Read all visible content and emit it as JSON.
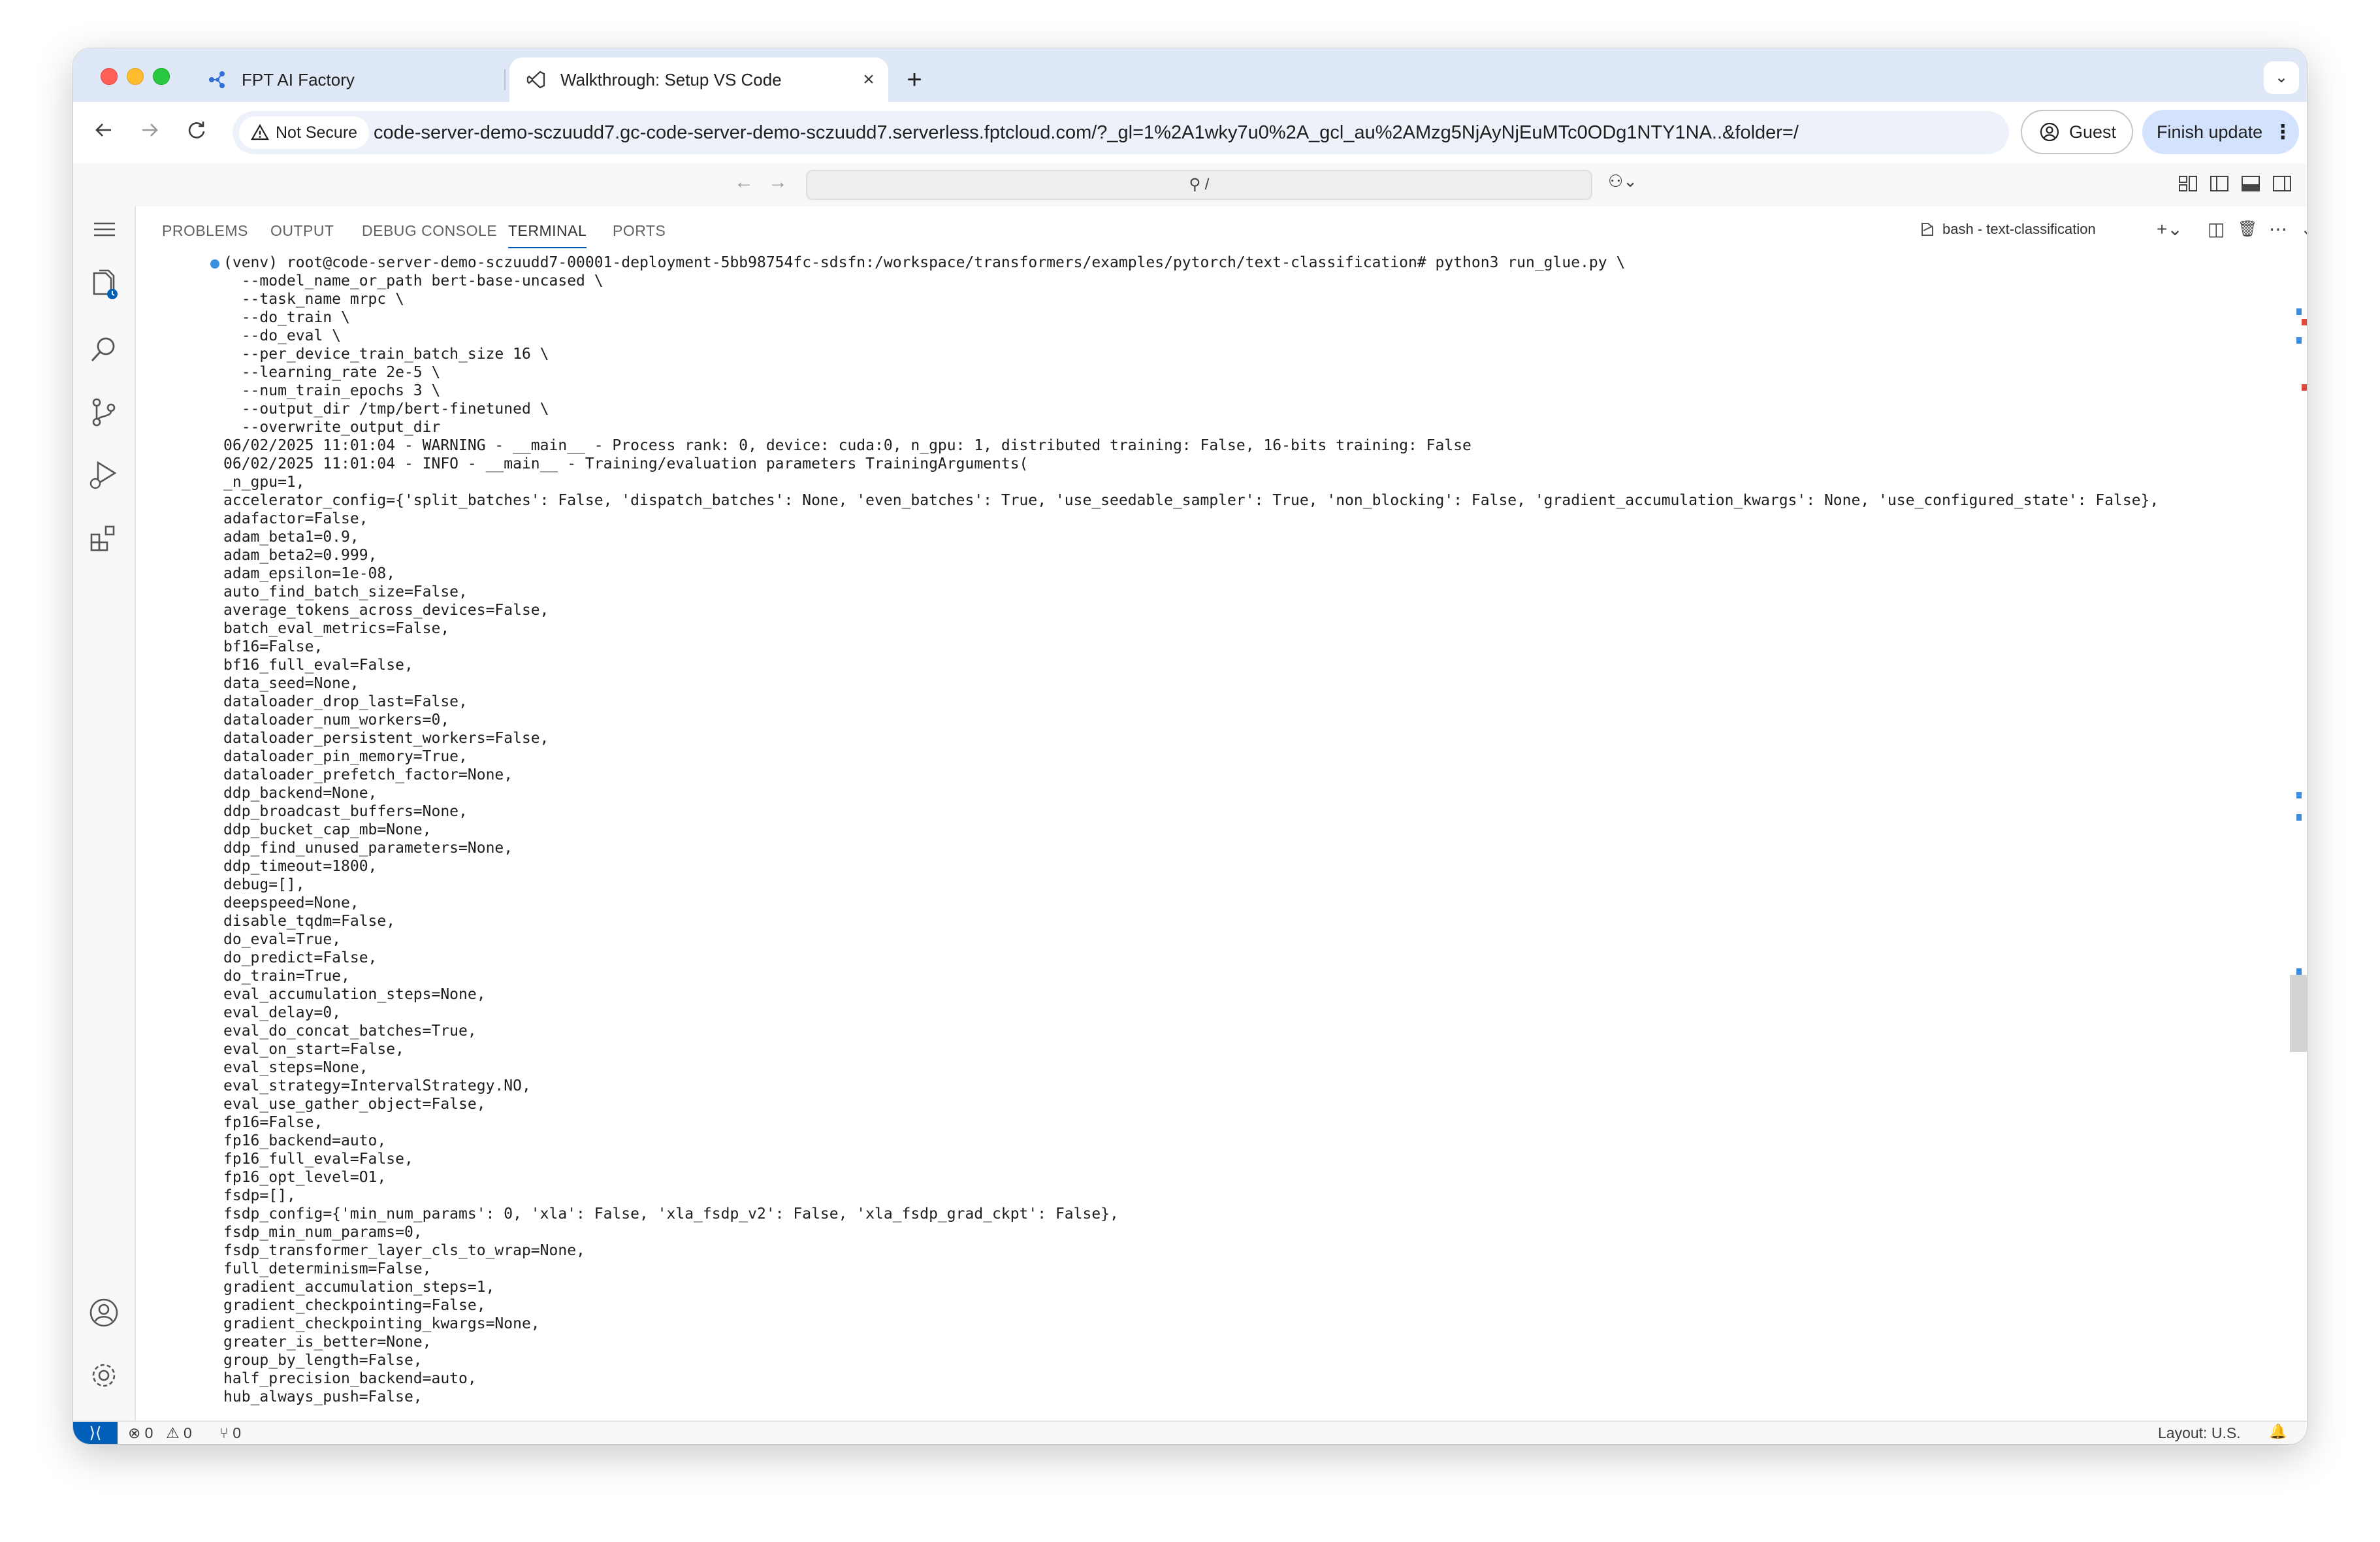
{
  "browser": {
    "tabs": [
      {
        "title": "FPT AI Factory",
        "close": "×",
        "icon": "fpt-network-icon"
      },
      {
        "title": "Walkthrough: Setup VS Code",
        "close": "×",
        "icon": "vscode-icon"
      }
    ],
    "new_tab": "+",
    "tab_menu": "⌄",
    "security_label": "Not Secure",
    "url": "code-server-demo-sczuudd7.gc-code-server-demo-sczuudd7.serverless.fptcloud.com/?_gl=1%2A1wky7u0%2A_gcl_au%2AMzg5NjAyNjEuMTc0ODg1NTY1NA..&folder=/",
    "guest_label": "Guest",
    "update_label": "Finish update",
    "update_menu": "⋮"
  },
  "vscode": {
    "command_center": {
      "search_text": "⚲ /",
      "back": "←",
      "forward": "→",
      "copilot": "⚇⌄"
    },
    "panel": {
      "tabs": [
        {
          "label": "PROBLEMS",
          "active": false
        },
        {
          "label": "OUTPUT",
          "active": false
        },
        {
          "label": "DEBUG CONSOLE",
          "active": false
        },
        {
          "label": "TERMINAL",
          "active": true
        },
        {
          "label": "PORTS",
          "active": false
        }
      ],
      "terminal_name": "bash - text-classification",
      "actions": {
        "new": "+⌄",
        "split": "◫",
        "kill": "🗑",
        "more": "⋯",
        "collapse": "⌄",
        "close": "✕"
      }
    },
    "terminal_lines": [
      "(venv) root@code-server-demo-sczuudd7-00001-deployment-5bb98754fc-sdsfn:/workspace/transformers/examples/pytorch/text-classification# python3 run_glue.py \\",
      "  --model_name_or_path bert-base-uncased \\",
      "  --task_name mrpc \\",
      "  --do_train \\",
      "  --do_eval \\",
      "  --per_device_train_batch_size 16 \\",
      "  --learning_rate 2e-5 \\",
      "  --num_train_epochs 3 \\",
      "  --output_dir /tmp/bert-finetuned \\",
      "  --overwrite_output_dir",
      "06/02/2025 11:01:04 - WARNING - __main__ - Process rank: 0, device: cuda:0, n_gpu: 1, distributed training: False, 16-bits training: False",
      "06/02/2025 11:01:04 - INFO - __main__ - Training/evaluation parameters TrainingArguments(",
      "_n_gpu=1,",
      "accelerator_config={'split_batches': False, 'dispatch_batches': None, 'even_batches': True, 'use_seedable_sampler': True, 'non_blocking': False, 'gradient_accumulation_kwargs': None, 'use_configured_state': False},",
      "adafactor=False,",
      "adam_beta1=0.9,",
      "adam_beta2=0.999,",
      "adam_epsilon=1e-08,",
      "auto_find_batch_size=False,",
      "average_tokens_across_devices=False,",
      "batch_eval_metrics=False,",
      "bf16=False,",
      "bf16_full_eval=False,",
      "data_seed=None,",
      "dataloader_drop_last=False,",
      "dataloader_num_workers=0,",
      "dataloader_persistent_workers=False,",
      "dataloader_pin_memory=True,",
      "dataloader_prefetch_factor=None,",
      "ddp_backend=None,",
      "ddp_broadcast_buffers=None,",
      "ddp_bucket_cap_mb=None,",
      "ddp_find_unused_parameters=None,",
      "ddp_timeout=1800,",
      "debug=[],",
      "deepspeed=None,",
      "disable_tqdm=False,",
      "do_eval=True,",
      "do_predict=False,",
      "do_train=True,",
      "eval_accumulation_steps=None,",
      "eval_delay=0,",
      "eval_do_concat_batches=True,",
      "eval_on_start=False,",
      "eval_steps=None,",
      "eval_strategy=IntervalStrategy.NO,",
      "eval_use_gather_object=False,",
      "fp16=False,",
      "fp16_backend=auto,",
      "fp16_full_eval=False,",
      "fp16_opt_level=O1,",
      "fsdp=[],",
      "fsdp_config={'min_num_params': 0, 'xla': False, 'xla_fsdp_v2': False, 'xla_fsdp_grad_ckpt': False},",
      "fsdp_min_num_params=0,",
      "fsdp_transformer_layer_cls_to_wrap=None,",
      "full_determinism=False,",
      "gradient_accumulation_steps=1,",
      "gradient_checkpointing=False,",
      "gradient_checkpointing_kwargs=None,",
      "greater_is_better=None,",
      "group_by_length=False,",
      "half_precision_backend=auto,",
      "hub_always_push=False,"
    ],
    "status_bar": {
      "remote": "⟩⟨",
      "errors": "⊗ 0",
      "warnings": "⚠ 0",
      "ports": "⑂ 0",
      "layout": "Layout: U.S.",
      "bell": "🔔"
    }
  },
  "colors": {
    "accent": "#005fb8",
    "tab_strip": "#dfe8f7",
    "omnibox": "#edf2fa",
    "update_button": "#d3e3fd"
  }
}
